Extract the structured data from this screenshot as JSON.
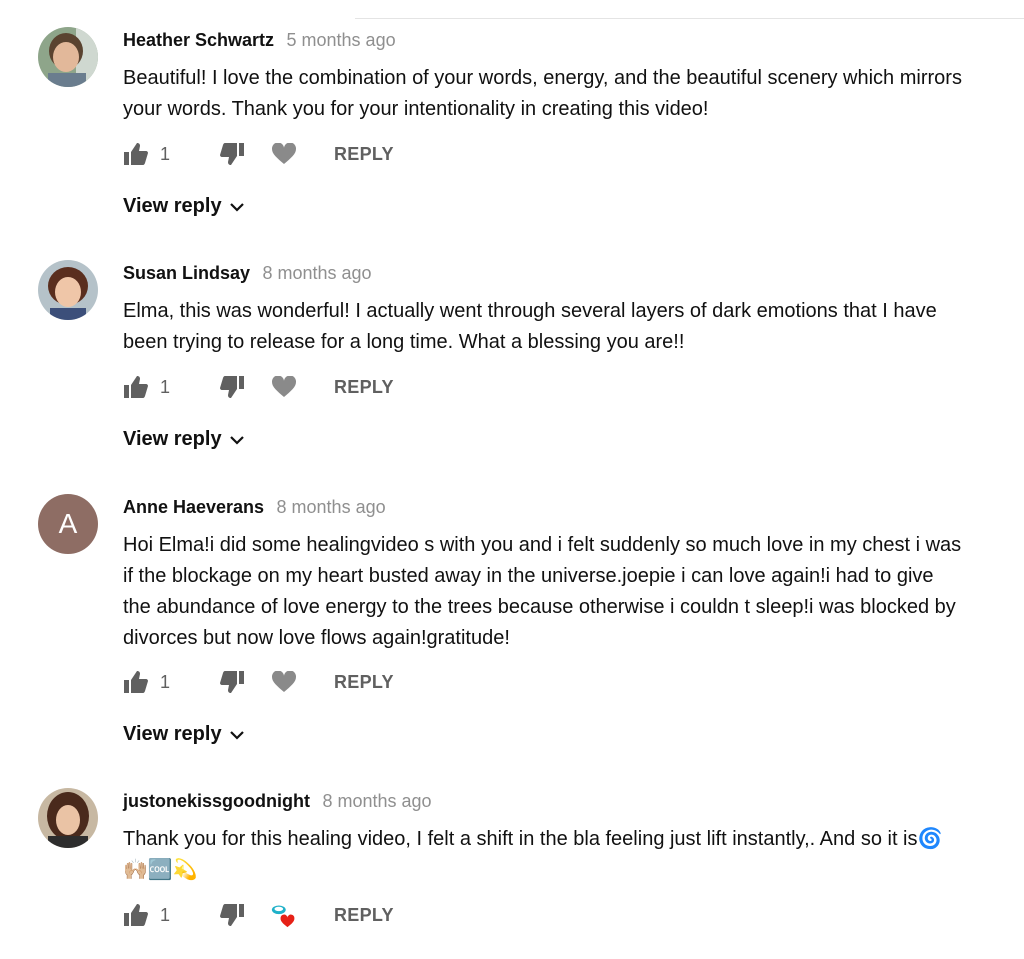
{
  "comments": [
    {
      "author": "Heather Schwartz",
      "time": "5 months ago",
      "text": "Beautiful! I love the combination of your words, energy, and the beautiful scenery which mirrors your words. Thank you for your intentionality in creating this video!",
      "likes": "1",
      "reply_label": "REPLY",
      "view_reply_label": "View reply"
    },
    {
      "author": "Susan Lindsay",
      "time": "8 months ago",
      "text": "Elma, this was wonderful!  I actually went through several layers of dark emotions that I have been trying to release for a long time.  What a blessing you are!!",
      "likes": "1",
      "reply_label": "REPLY",
      "view_reply_label": "View reply"
    },
    {
      "author": "Anne Haeverans",
      "avatar_letter": "A",
      "time": "8 months ago",
      "text": "Hoi Elma!i did some healingvideo s with you and i felt suddenly so much love in my chest i was if the blockage on my heart busted away in the universe.joepie i can love again!i had to give the abundance of love energy to the trees because otherwise i couldn t sleep!i was blocked by divorces but now love flows again!gratitude!",
      "likes": "1",
      "reply_label": "REPLY",
      "view_reply_label": "View reply"
    },
    {
      "author": "justonekissgoodnight",
      "time": "8 months ago",
      "text": "Thank you for this healing video, I felt a shift in the bla feeling just lift instantly,. And so it is",
      "text_emojis": "🌀🙌🏼🆒💫",
      "likes": "1",
      "reply_label": "REPLY"
    }
  ],
  "colors": {
    "author": "#111111",
    "timestamp": "#8f8f8f",
    "action_gray": "#606060",
    "letter_avatar_bg": "#8e6d64",
    "creator_heart": "#e62117"
  },
  "icons": [
    "thumb-up-icon",
    "thumb-down-icon",
    "heart-icon",
    "creator-heart-icon",
    "chevron-down-icon"
  ]
}
